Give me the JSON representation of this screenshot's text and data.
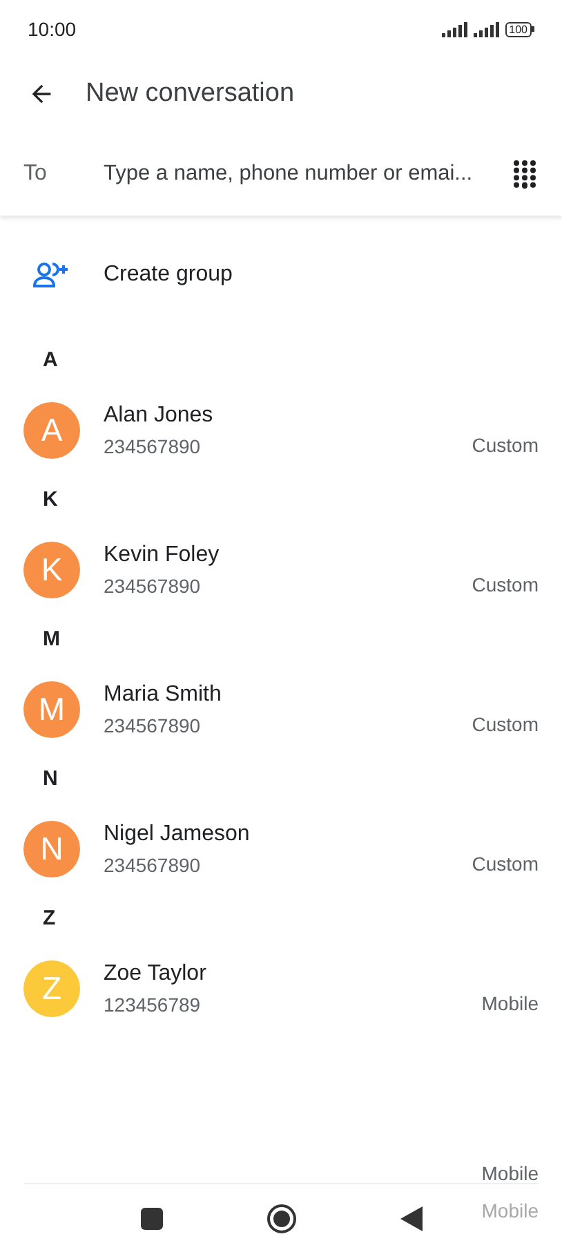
{
  "status_bar": {
    "time": "10:00",
    "battery": "100"
  },
  "header": {
    "title": "New conversation"
  },
  "to_field": {
    "label": "To",
    "placeholder": "Type a name, phone number or emai..."
  },
  "create_group": {
    "label": "Create group"
  },
  "sections": [
    {
      "letter": "A",
      "contacts": [
        {
          "initial": "A",
          "name": "Alan Jones",
          "number": "234567890",
          "type": "Custom",
          "color": "#f79046"
        }
      ]
    },
    {
      "letter": "K",
      "contacts": [
        {
          "initial": "K",
          "name": "Kevin Foley",
          "number": "234567890",
          "type": "Custom",
          "color": "#f79046"
        }
      ]
    },
    {
      "letter": "M",
      "contacts": [
        {
          "initial": "M",
          "name": "Maria Smith",
          "number": "234567890",
          "type": "Custom",
          "color": "#f79046"
        }
      ]
    },
    {
      "letter": "N",
      "contacts": [
        {
          "initial": "N",
          "name": "Nigel Jameson",
          "number": "234567890",
          "type": "Custom",
          "color": "#f79046"
        }
      ]
    },
    {
      "letter": "Z",
      "contacts": [
        {
          "initial": "Z",
          "name": "Zoe Taylor",
          "number": "123456789",
          "type": "Mobile",
          "color": "#fbc93a"
        }
      ]
    }
  ],
  "trailing_labels": [
    {
      "text": "Mobile",
      "faded": false
    },
    {
      "text": "Mobile",
      "faded": true
    }
  ]
}
